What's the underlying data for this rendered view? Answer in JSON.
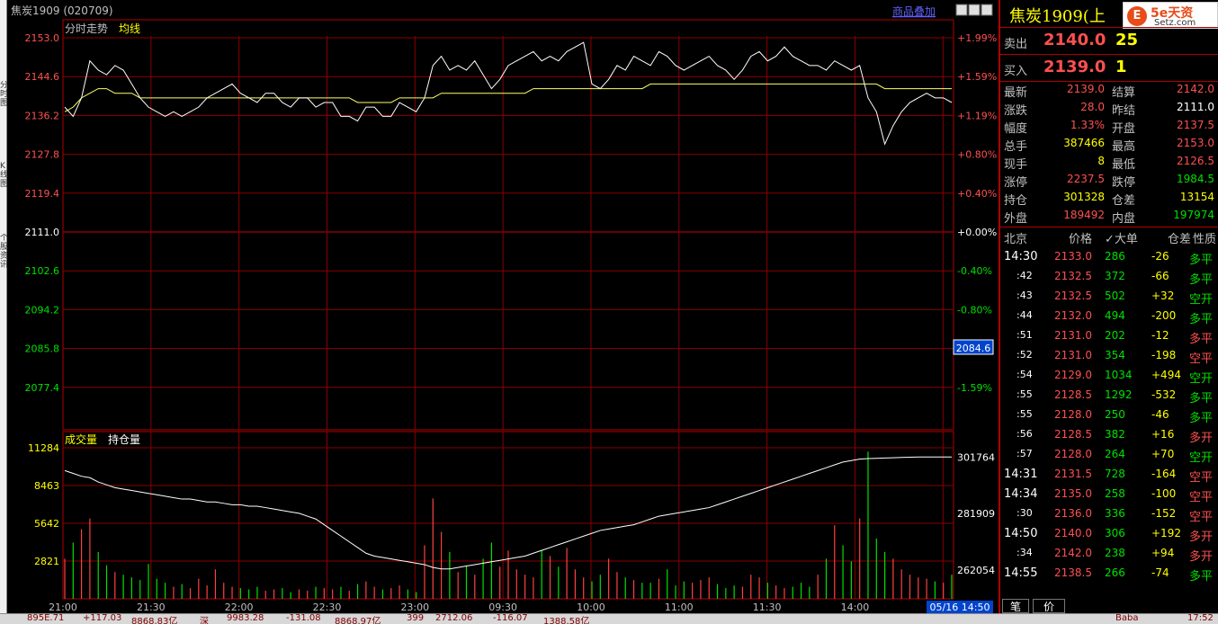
{
  "header": {
    "instrument": "焦炭1909 (020709)",
    "overlay_label": "商品叠加"
  },
  "upper": {
    "label_trend": "分时走势",
    "label_avg": "均线",
    "price_ticks": [
      "2153.0",
      "2144.6",
      "2136.2",
      "2127.8",
      "2119.4",
      "2111.0",
      "2102.6",
      "2094.2",
      "2085.8",
      "2077.4"
    ],
    "pct_ticks": [
      "+1.99%",
      "+1.59%",
      "+1.19%",
      "+0.80%",
      "+0.40%",
      "+0.00%",
      "-0.40%",
      "-0.80%",
      "",
      "-1.59%"
    ],
    "crosshair_value": "2084.6"
  },
  "lower": {
    "label_vol": "成交量",
    "label_oi": "持仓量",
    "vol_ticks": [
      "11284",
      "8463",
      "5642",
      "2821"
    ],
    "oi_ticks": [
      "301764",
      "281909",
      "262054"
    ]
  },
  "time_axis": [
    "21:00",
    "21:30",
    "22:00",
    "22:30",
    "23:00",
    "09:30",
    "10:00",
    "11:00",
    "11:30",
    "14:00",
    "14:30"
  ],
  "time_stamp": "05/16 14:50",
  "chart_data": {
    "type": "line",
    "price_series_name": "分时走势",
    "avg_series_name": "均线",
    "prev_settle": 2111.0,
    "ylim": [
      2069.0,
      2153.0
    ],
    "price": [
      2138,
      2136,
      2140,
      2148,
      2146,
      2145,
      2147,
      2146,
      2143,
      2140,
      2138,
      2137,
      2136,
      2137,
      2136,
      2137,
      2138,
      2140,
      2141,
      2142,
      2143,
      2141,
      2140,
      2139,
      2141,
      2141,
      2139,
      2138,
      2140,
      2140,
      2138,
      2139,
      2139,
      2136,
      2136,
      2135,
      2138,
      2138,
      2136,
      2136,
      2139,
      2138,
      2137,
      2140,
      2147,
      2149,
      2146,
      2147,
      2146,
      2148,
      2145,
      2142,
      2144,
      2147,
      2148,
      2149,
      2150,
      2148,
      2149,
      2148,
      2150,
      2151,
      2152,
      2143,
      2142,
      2144,
      2147,
      2146,
      2149,
      2148,
      2147,
      2150,
      2149,
      2147,
      2146,
      2147,
      2148,
      2149,
      2147,
      2146,
      2144,
      2146,
      2149,
      2150,
      2148,
      2149,
      2151,
      2149,
      2148,
      2147,
      2147,
      2146,
      2148,
      2147,
      2146,
      2147,
      2140,
      2137,
      2130,
      2134,
      2137,
      2139,
      2140,
      2141,
      2140,
      2140,
      2139
    ],
    "avg": [
      2137,
      2138,
      2140,
      2141,
      2142,
      2142,
      2141,
      2141,
      2141,
      2140,
      2140,
      2140,
      2140,
      2140,
      2140,
      2140,
      2140,
      2140,
      2140,
      2140,
      2140,
      2140,
      2140,
      2140,
      2140,
      2140,
      2140,
      2140,
      2140,
      2140,
      2140,
      2140,
      2140,
      2140,
      2140,
      2139,
      2139,
      2139,
      2139,
      2139,
      2140,
      2140,
      2140,
      2140,
      2140,
      2141,
      2141,
      2141,
      2141,
      2141,
      2141,
      2141,
      2141,
      2141,
      2141,
      2141,
      2142,
      2142,
      2142,
      2142,
      2142,
      2142,
      2142,
      2142,
      2142,
      2142,
      2142,
      2142,
      2142,
      2142,
      2143,
      2143,
      2143,
      2143,
      2143,
      2143,
      2143,
      2143,
      2143,
      2143,
      2143,
      2143,
      2143,
      2143,
      2143,
      2143,
      2143,
      2143,
      2143,
      2143,
      2143,
      2143,
      2143,
      2143,
      2143,
      2143,
      2143,
      2143,
      2142,
      2142,
      2142,
      2142,
      2142,
      2142,
      2142,
      2142,
      2142
    ],
    "oi_ylim": [
      252000,
      305000
    ],
    "open_interest": [
      297000,
      296000,
      295000,
      294500,
      293000,
      292000,
      291000,
      290500,
      290000,
      289500,
      289000,
      288500,
      288000,
      287500,
      287000,
      287000,
      286500,
      286000,
      286000,
      285500,
      285000,
      285000,
      284500,
      284500,
      284000,
      283500,
      283000,
      282500,
      282000,
      281000,
      280000,
      278000,
      276000,
      274000,
      272000,
      270000,
      268000,
      267000,
      266500,
      266000,
      265500,
      265000,
      264500,
      264000,
      263000,
      262500,
      262500,
      263000,
      263500,
      264000,
      264500,
      265000,
      265500,
      266000,
      266500,
      267000,
      268000,
      269000,
      270000,
      271000,
      272000,
      273000,
      274000,
      275000,
      276000,
      276500,
      277000,
      277500,
      278000,
      279000,
      280000,
      281000,
      281500,
      282000,
      282500,
      283000,
      283500,
      284000,
      285000,
      286000,
      287000,
      288000,
      289000,
      290000,
      291000,
      292000,
      293000,
      294000,
      295000,
      296000,
      297000,
      298000,
      299000,
      300000,
      300500,
      301000,
      301200,
      301300,
      301400,
      301500,
      301600,
      301700,
      301764,
      301764,
      301764,
      301764,
      301764
    ],
    "vol_ylim": [
      0,
      11284
    ],
    "volume": [
      3000,
      4200,
      5200,
      6000,
      3500,
      2500,
      2000,
      1800,
      1600,
      1400,
      2600,
      1500,
      1200,
      900,
      1100,
      800,
      1500,
      1000,
      2200,
      1200,
      900,
      800,
      700,
      900,
      600,
      700,
      800,
      500,
      700,
      600,
      900,
      800,
      700,
      900,
      600,
      1100,
      1300,
      900,
      700,
      800,
      1000,
      700,
      500,
      4000,
      7500,
      5000,
      3500,
      2000,
      2500,
      1800,
      3000,
      4200,
      2400,
      3600,
      2200,
      1800,
      1600,
      3600,
      3200,
      2400,
      3800,
      2200,
      1600,
      1300,
      1800,
      3000,
      2000,
      1600,
      1400,
      1200,
      1200,
      1500,
      2200,
      1000,
      1300,
      1200,
      1400,
      1600,
      1100,
      800,
      1000,
      900,
      1800,
      1600,
      1200,
      1000,
      800,
      900,
      1200,
      900,
      1800,
      3000,
      5500,
      4000,
      2800,
      6000,
      11000,
      4500,
      3500,
      3000,
      2200,
      1800,
      1600,
      1500,
      1300,
      1200,
      1800
    ]
  },
  "right_panel": {
    "title": "焦炭1909(上",
    "logo_big": "5e天资",
    "logo_small": "Setz.com",
    "logo_glyph": "E",
    "sell": {
      "label": "卖出",
      "price": "2140.0",
      "qty": "25"
    },
    "buy": {
      "label": "买入",
      "price": "2139.0",
      "qty": "1"
    },
    "quotes": [
      {
        "l1": "最新",
        "v1": "2139.0",
        "c1": "red",
        "l2": "结算",
        "v2": "2142.0",
        "c2": "red"
      },
      {
        "l1": "涨跌",
        "v1": "28.0",
        "c1": "red",
        "l2": "昨结",
        "v2": "2111.0",
        "c2": "white"
      },
      {
        "l1": "幅度",
        "v1": "1.33%",
        "c1": "red",
        "l2": "开盘",
        "v2": "2137.5",
        "c2": "red"
      },
      {
        "l1": "总手",
        "v1": "387466",
        "c1": "yellow",
        "l2": "最高",
        "v2": "2153.0",
        "c2": "red"
      },
      {
        "l1": "现手",
        "v1": "8",
        "c1": "yellow",
        "l2": "最低",
        "v2": "2126.5",
        "c2": "red"
      },
      {
        "l1": "涨停",
        "v1": "2237.5",
        "c1": "red",
        "l2": "跌停",
        "v2": "1984.5",
        "c2": "green"
      },
      {
        "l1": "持仓",
        "v1": "301328",
        "c1": "yellow",
        "l2": "仓差",
        "v2": "13154",
        "c2": "yellow"
      },
      {
        "l1": "外盘",
        "v1": "189492",
        "c1": "red",
        "l2": "内盘",
        "v2": "197974",
        "c2": "green"
      }
    ],
    "tick_header": {
      "time": "北京",
      "price": "价格",
      "vol": "✓大单",
      "oi": "仓差",
      "nature": "性质"
    },
    "ticks": [
      {
        "t": "14:30",
        "p": "2133.0",
        "pc": "red",
        "v": "286",
        "d": "-26",
        "n": "多平",
        "nc": "green"
      },
      {
        "t": ":42",
        "p": "2132.5",
        "pc": "red",
        "v": "372",
        "d": "-66",
        "n": "多平",
        "nc": "green"
      },
      {
        "t": ":43",
        "p": "2132.5",
        "pc": "red",
        "v": "502",
        "d": "+32",
        "n": "空开",
        "nc": "green"
      },
      {
        "t": ":44",
        "p": "2132.0",
        "pc": "red",
        "v": "494",
        "d": "-200",
        "n": "多平",
        "nc": "green"
      },
      {
        "t": ":51",
        "p": "2131.0",
        "pc": "red",
        "v": "202",
        "d": "-12",
        "n": "多平",
        "nc": "red"
      },
      {
        "t": ":52",
        "p": "2131.0",
        "pc": "red",
        "v": "354",
        "d": "-198",
        "n": "空平",
        "nc": "red"
      },
      {
        "t": ":54",
        "p": "2129.0",
        "pc": "red",
        "v": "1034",
        "d": "+494",
        "n": "空开",
        "nc": "green"
      },
      {
        "t": ":55",
        "p": "2128.5",
        "pc": "red",
        "v": "1292",
        "d": "-532",
        "n": "多平",
        "nc": "green"
      },
      {
        "t": ":55",
        "p": "2128.0",
        "pc": "red",
        "v": "250",
        "d": "-46",
        "n": "多平",
        "nc": "green"
      },
      {
        "t": ":56",
        "p": "2128.5",
        "pc": "red",
        "v": "382",
        "d": "+16",
        "n": "多开",
        "nc": "red"
      },
      {
        "t": ":57",
        "p": "2128.0",
        "pc": "red",
        "v": "264",
        "d": "+70",
        "n": "空开",
        "nc": "green"
      },
      {
        "t": "14:31",
        "p": "2131.5",
        "pc": "red",
        "v": "728",
        "d": "-164",
        "n": "空平",
        "nc": "red"
      },
      {
        "t": "14:34",
        "p": "2135.0",
        "pc": "red",
        "v": "258",
        "d": "-100",
        "n": "空平",
        "nc": "red"
      },
      {
        "t": ":30",
        "p": "2136.0",
        "pc": "red",
        "v": "336",
        "d": "-152",
        "n": "空平",
        "nc": "red"
      },
      {
        "t": "14:50",
        "p": "2140.0",
        "pc": "red",
        "v": "306",
        "d": "+192",
        "n": "多开",
        "nc": "red"
      },
      {
        "t": ":34",
        "p": "2142.0",
        "pc": "red",
        "v": "238",
        "d": "+94",
        "n": "多开",
        "nc": "red"
      },
      {
        "t": "14:55",
        "p": "2138.5",
        "pc": "red",
        "v": "266",
        "d": "-74",
        "n": "多平",
        "nc": "green"
      }
    ],
    "tabs": [
      "笔",
      "价"
    ]
  },
  "left_tabs": [
    "分时图",
    "K线图",
    "个股资讯"
  ],
  "bottom_bar": [
    "895E.71",
    "+117.03",
    "8868.83亿",
    "深",
    "9983.28",
    "-131.08",
    "8868.97亿",
    "399",
    "2712.06",
    "-116.07",
    "1388.58亿",
    "Baba",
    "17:52"
  ]
}
